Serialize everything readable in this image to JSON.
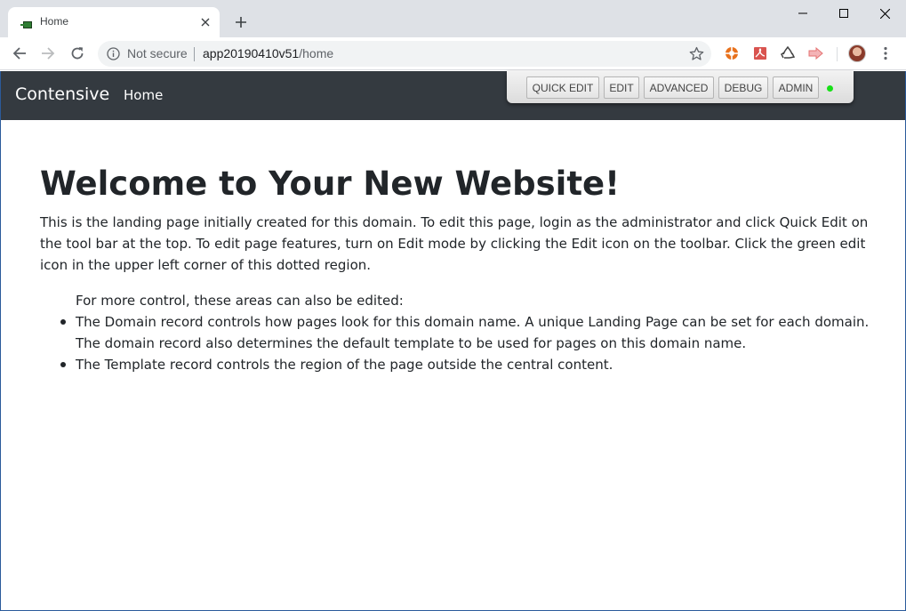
{
  "browser": {
    "tab_title": "Home",
    "omnibox": {
      "security_label": "Not secure",
      "url_host": "app20190410v51",
      "url_path": "/home"
    }
  },
  "site": {
    "brand": "Contensive",
    "nav_home": "Home",
    "cms_toolbar": {
      "quick_edit": "QUICK EDIT",
      "edit": "EDIT",
      "advanced": "ADVANCED",
      "debug": "DEBUG",
      "admin": "ADMIN",
      "status_color": "#18e018"
    }
  },
  "content": {
    "headline": "Welcome to Your New Website!",
    "intro": "This is the landing page initially created for this domain. To edit this page, login as the administrator and click Quick Edit on the tool bar at the top. To edit page features, turn on Edit mode by clicking the Edit icon on the toolbar. Click the green edit icon in the upper left corner of this dotted region.",
    "more_label": "For more control, these areas can also be edited:",
    "items": [
      "The Domain record controls how pages look for this domain name. A unique Landing Page can be set for each domain. The domain record also determines the default template to be used for pages on this domain name.",
      "The Template record controls the region of the page outside the central content."
    ]
  }
}
